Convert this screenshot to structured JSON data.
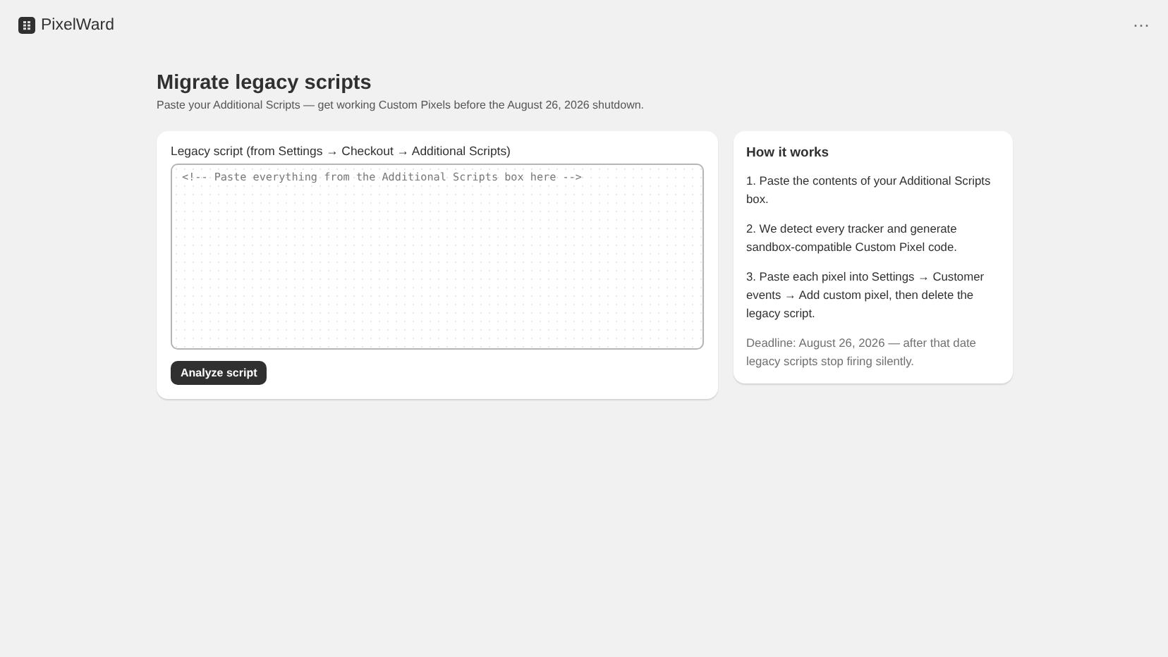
{
  "app": {
    "name": "PixelWard",
    "menu_icon": "⋯"
  },
  "page": {
    "title": "Migrate legacy scripts",
    "subtitle": "Paste your Additional Scripts — get working Custom Pixels before the August 26, 2026 shutdown."
  },
  "form": {
    "label": "Legacy script (from Settings → Checkout → Additional Scripts)",
    "placeholder": "<!-- Paste everything from the Additional Scripts box here -->",
    "button": "Analyze script"
  },
  "help": {
    "title": "How it works",
    "steps": [
      "1. Paste the contents of your Additional Scripts box.",
      "2. We detect every tracker and generate sandbox-compatible Custom Pixel code.",
      "3. Paste each pixel into Settings → Customer events → Add custom pixel, then delete the legacy script."
    ],
    "note": "Deadline: August 26, 2026 — after that date legacy scripts stop firing silently."
  }
}
